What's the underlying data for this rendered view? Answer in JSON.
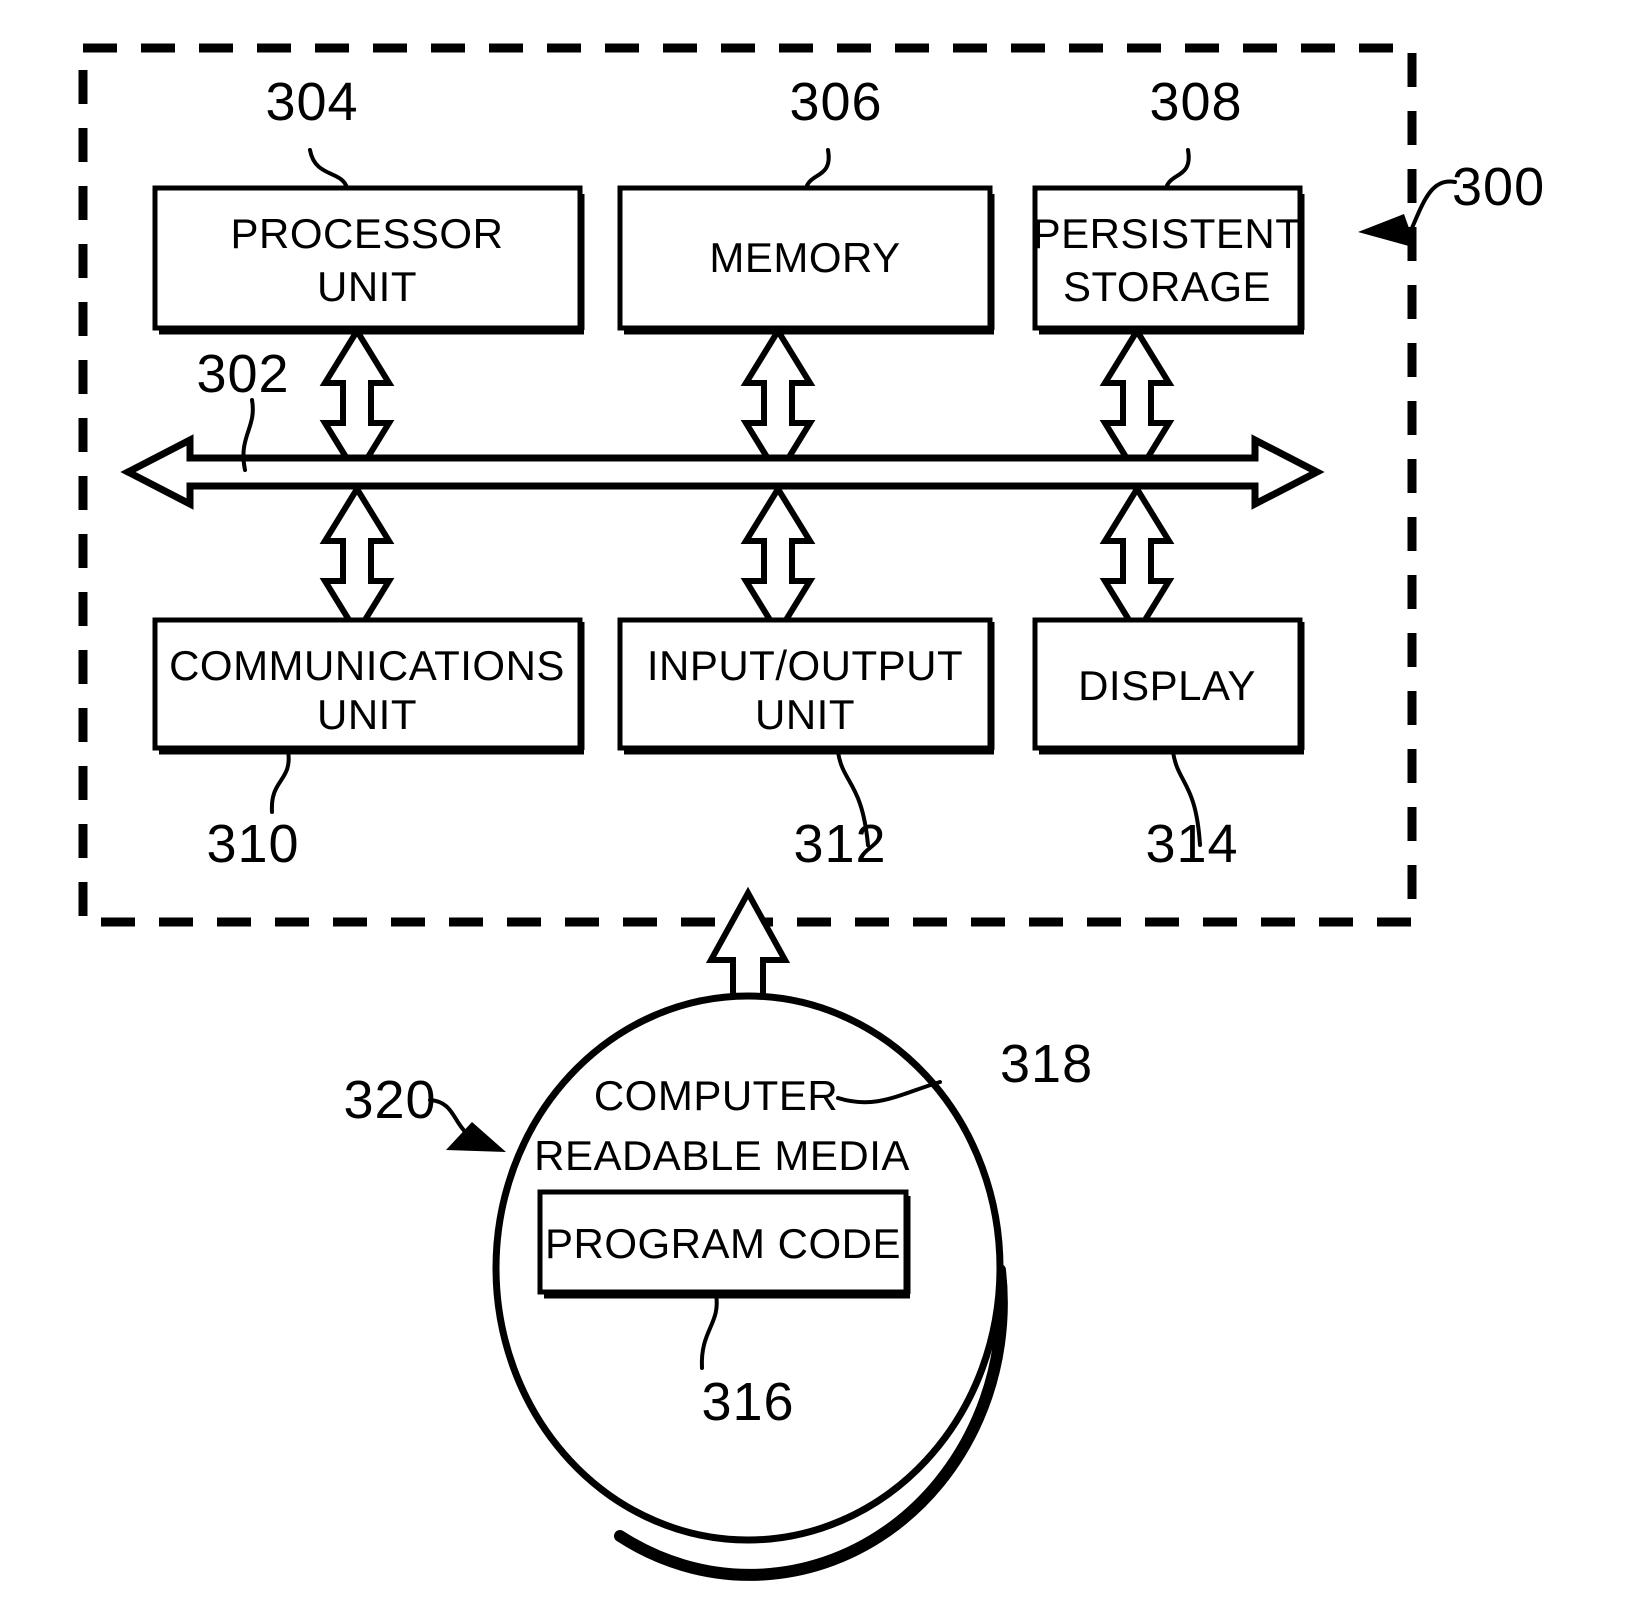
{
  "figure": {
    "type": "patent-block-diagram",
    "system_reference": "300",
    "bus_reference": "302"
  },
  "frame": {
    "name": "data-processing-system-boundary",
    "style": "dashed",
    "reference": "300"
  },
  "bus": {
    "label": "302",
    "name": "communications-fabric-bus",
    "style": "double-headed-hollow-arrow"
  },
  "top_row": [
    {
      "label": "PROCESSOR UNIT",
      "line1": "PROCESSOR",
      "line2": "UNIT",
      "reference": "304"
    },
    {
      "label": "MEMORY",
      "line1": "MEMORY",
      "line2": "",
      "reference": "306"
    },
    {
      "label": "PERSISTENT STORAGE",
      "line1": "PERSISTENT",
      "line2": "STORAGE",
      "reference": "308"
    }
  ],
  "bottom_row": [
    {
      "label": "COMMUNICATIONS UNIT",
      "line1": "COMMUNICATIONS",
      "line2": "UNIT",
      "reference": "310"
    },
    {
      "label": "INPUT/OUTPUT UNIT",
      "line1": "INPUT/OUTPUT",
      "line2": "UNIT",
      "reference": "312"
    },
    {
      "label": "DISPLAY",
      "line1": "DISPLAY",
      "line2": "",
      "reference": "314"
    }
  ],
  "media": {
    "title_line1": "COMPUTER",
    "title_line2": "READABLE MEDIA",
    "media_reference": "318",
    "product_reference": "320",
    "program_code_label": "PROGRAM CODE",
    "program_code_reference": "316"
  },
  "colors": {
    "stroke": "#000000",
    "fill": "#ffffff",
    "background": "#ffffff"
  }
}
